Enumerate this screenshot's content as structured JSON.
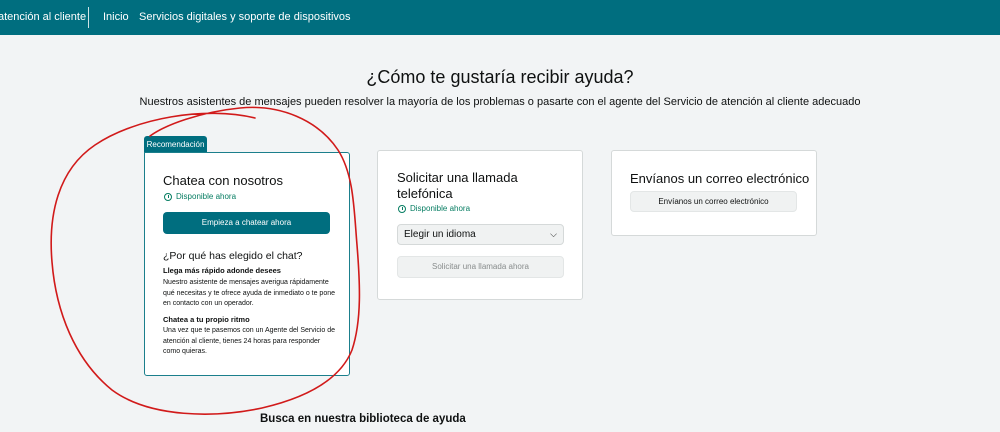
{
  "topbar": {
    "items": [
      "atención al cliente",
      "Inicio",
      "Servicios digitales y soporte de dispositivos"
    ]
  },
  "page": {
    "heading": "¿Cómo te gustaría recibir ayuda?",
    "subheading": "Nuestros asistentes de mensajes pueden resolver la mayoría de los problemas o pasarte con el agente del Servicio de atención al cliente adecuado",
    "bottom_link": "Busca en nuestra biblioteca de ayuda"
  },
  "chat_card": {
    "badge": "Recomendación",
    "title": "Chatea con nosotros",
    "availability": "Disponible ahora",
    "button": "Empieza a chatear ahora",
    "why_title": "¿Por qué has elegido el chat?",
    "reasons": [
      {
        "title": "Llega más rápido adonde desees",
        "text": "Nuestro asistente de mensajes averigua rápidamente qué necesitas y te ofrece ayuda de inmediato o te pone en contacto con un operador."
      },
      {
        "title": "Chatea a tu propio ritmo",
        "text": "Una vez que te pasemos con un Agente del Servicio de atención al cliente, tienes 24 horas para responder como quieras."
      }
    ]
  },
  "call_card": {
    "title_line1": "Solicitar una llamada",
    "title_line2": "telefónica",
    "availability": "Disponible ahora",
    "select_value": "Elegir un idioma",
    "button": "Solicitar una llamada ahora"
  },
  "email_card": {
    "title": "Envíanos un correo electrónico",
    "button": "Envíanos un correo electrónico"
  },
  "colors": {
    "brand": "#006e7f",
    "available": "#067d62",
    "annotation": "#d11a1a"
  }
}
